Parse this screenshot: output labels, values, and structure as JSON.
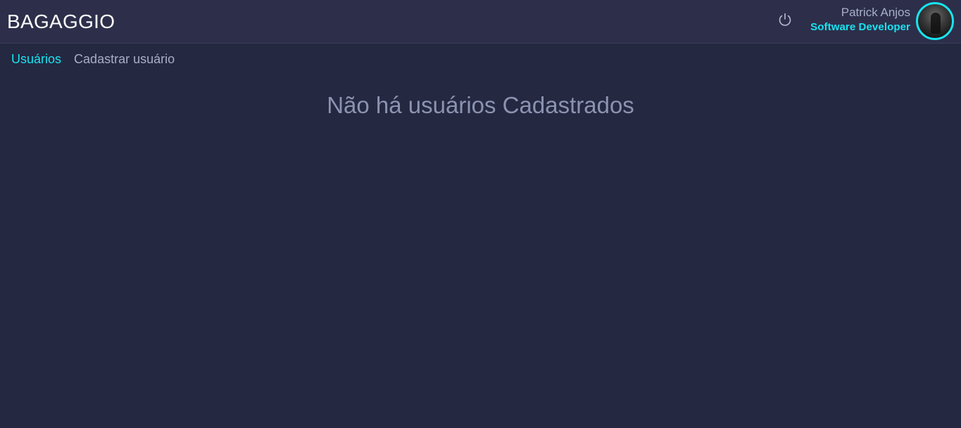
{
  "header": {
    "brand": "BAGAGGIO",
    "power_icon": "power-icon",
    "user": {
      "name": "Patrick Anjos",
      "role": "Software Developer",
      "avatar_icon": "avatar"
    }
  },
  "nav": {
    "items": [
      {
        "label": "Usuários",
        "active": true
      },
      {
        "label": "Cadastrar usuário",
        "active": false
      }
    ]
  },
  "main": {
    "empty_message": "Não há usuários Cadastrados"
  },
  "colors": {
    "background": "#242840",
    "header": "#2d2f4a",
    "accent": "#19e3f0",
    "muted_text": "#a9aec7"
  }
}
